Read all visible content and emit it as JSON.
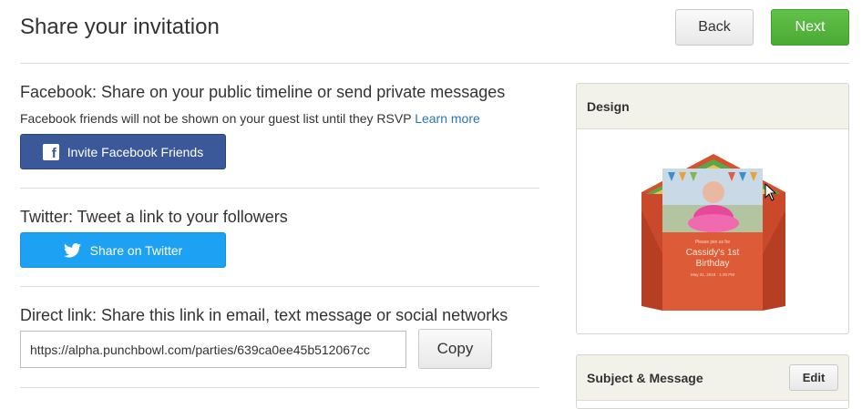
{
  "header": {
    "title": "Share your invitation",
    "back_label": "Back",
    "next_label": "Next"
  },
  "facebook": {
    "heading": "Facebook: Share on your public timeline or send private messages",
    "note": "Facebook friends will not be shown on your guest list until they RSVP",
    "learn_more": "Learn more",
    "button_label": "Invite Facebook Friends",
    "icon": "facebook-icon"
  },
  "twitter": {
    "heading": "Twitter: Tweet a link to your followers",
    "button_label": "Share on Twitter",
    "icon": "twitter-icon"
  },
  "direct_link": {
    "heading": "Direct link: Share this link in email, text message or social networks",
    "url": "https://alpha.punchbowl.com/parties/639ca0ee45b512067cc",
    "copy_label": "Copy"
  },
  "sidebar": {
    "design_title": "Design",
    "card": {
      "line1": "Please join us for",
      "line2": "Cassidy's 1st",
      "line3": "Birthday",
      "line4": "May 31, 2018 · 1:30 PM"
    },
    "subject_title": "Subject & Message",
    "edit_label": "Edit"
  },
  "colors": {
    "facebook_blue": "#3b5998",
    "twitter_blue": "#1da1f2",
    "next_green": "#4aaa33",
    "link_blue": "#2a75b3",
    "envelope_orange": "#d4532e"
  }
}
